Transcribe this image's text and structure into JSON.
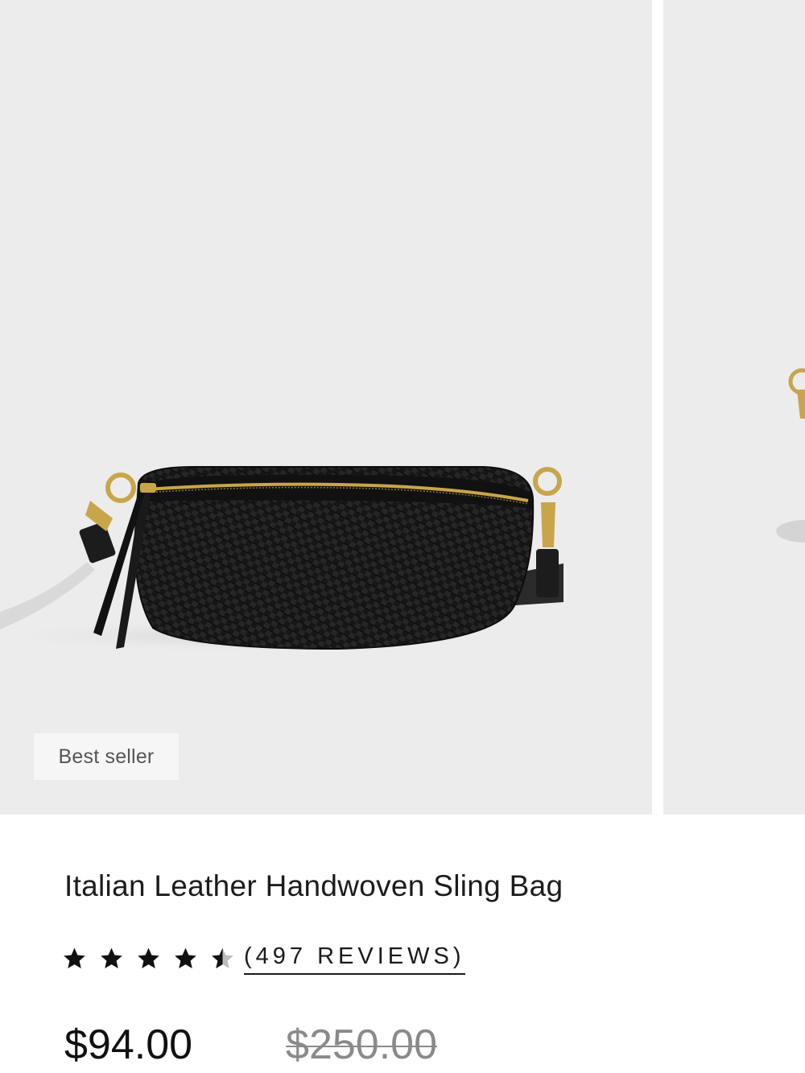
{
  "product": {
    "badge": "Best seller",
    "title": "Italian Leather Handwoven Sling Bag",
    "rating": {
      "value": 4.5,
      "max": 5,
      "reviews_label": "(497 REVIEWS)"
    },
    "price": {
      "sale": "$94.00",
      "original": "$250.00"
    }
  },
  "colors": {
    "image_background": "#ececec",
    "star": "#111111",
    "star_empty": "#bdbdbd"
  },
  "icons": {
    "star_full": "star-icon",
    "star_half": "star-half-icon"
  }
}
